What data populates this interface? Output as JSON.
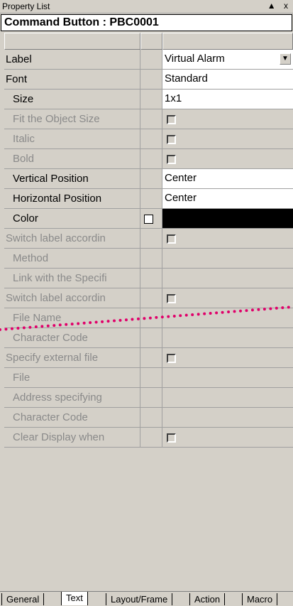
{
  "window": {
    "title": "Property List",
    "controls": "▲ x"
  },
  "caption": "Command Button : PBC0001",
  "rows": [
    {
      "label": "Label",
      "value": "Virtual Alarm"
    },
    {
      "label": "Font",
      "value": "Standard"
    },
    {
      "label": "Size",
      "value": "1x1"
    },
    {
      "label": "Fit the Object Size",
      "value": ""
    },
    {
      "label": "Italic",
      "value": ""
    },
    {
      "label": "Bold",
      "value": ""
    },
    {
      "label": "Vertical Position",
      "value": "Center"
    },
    {
      "label": "Horizontal Position",
      "value": "Center"
    },
    {
      "label": "Color",
      "value": ""
    },
    {
      "label": "Switch label accordin",
      "value": ""
    },
    {
      "label": "Method",
      "value": ""
    },
    {
      "label": "Link with the Specifi",
      "value": ""
    },
    {
      "label": "Switch label accordin",
      "value": ""
    },
    {
      "label": "File Name",
      "value": ""
    },
    {
      "label": "Character Code",
      "value": ""
    },
    {
      "label": "Specify external file",
      "value": ""
    },
    {
      "label": "File",
      "value": ""
    },
    {
      "label": "Address specifying",
      "value": ""
    },
    {
      "label": "Character Code",
      "value": ""
    },
    {
      "label": "Clear Display when",
      "value": ""
    }
  ],
  "tabs": [
    "General",
    "Text",
    "Layout/Frame",
    "Action",
    "Macro"
  ],
  "active_tab": "Text",
  "colors": {
    "panel": "#d4d0c8",
    "disabled_text": "#8a8a8a",
    "annotation": "#e0006a"
  }
}
